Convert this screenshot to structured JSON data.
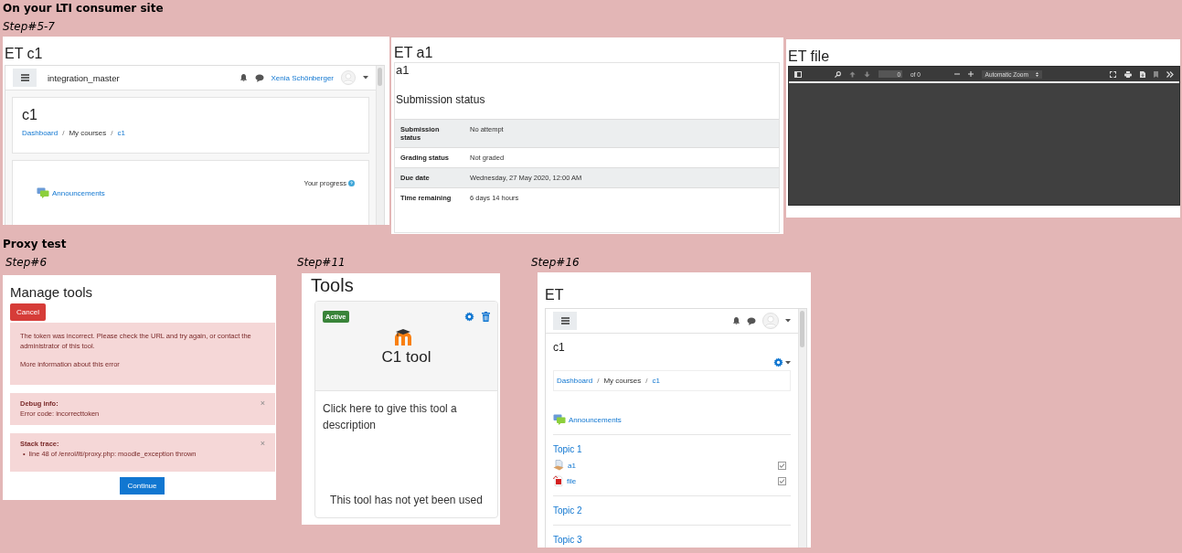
{
  "heading": "On your LTI consumer site",
  "consumer_step": "Step#5-7",
  "course_panel": {
    "title": "ET c1",
    "site_name": "integration_master",
    "user": "Xenia Schönberger",
    "course": "c1",
    "breadcrumb": [
      {
        "label": "Dashboard",
        "kind": "link"
      },
      {
        "separator": "/",
        "label": "My courses",
        "kind": "text"
      },
      {
        "separator": "/",
        "label": "c1",
        "kind": "link"
      }
    ],
    "progress_label": "Your progress",
    "activity": "Announcements"
  },
  "assignment_panel": {
    "title": "ET a1",
    "name": "a1",
    "section": "Submission status",
    "rows": [
      {
        "label": "Submission status",
        "value": "No attempt"
      },
      {
        "label": "Grading status",
        "value": "Not graded"
      },
      {
        "label": "Due date",
        "value": "Wednesday, 27 May 2020, 12:00 AM"
      },
      {
        "label": "Time remaining",
        "value": "6 days 14 hours"
      }
    ]
  },
  "file_panel": {
    "title": "ET file",
    "page": "0",
    "page_count": "of 0",
    "zoom": "Automatic Zoom"
  },
  "proxy_heading": "Proxy test",
  "error_panel": {
    "step": "Step#6",
    "title": "Manage tools",
    "cancel": "Cancel",
    "message": "The token was incorrect. Please check the URL and try again, or contact the administrator of this tool.",
    "more_link": "More information about this error",
    "debug": {
      "title": "Debug info:",
      "text": "Error code: incorrecttoken",
      "close": "×"
    },
    "stack": {
      "title": "Stack trace:",
      "items": [
        {
          "bullet": "•",
          "text": "line 48 of /enrol/lti/proxy.php: moodle_exception thrown"
        }
      ],
      "close": "×"
    },
    "continue": "Continue"
  },
  "tools_panel": {
    "step": "Step#11",
    "title": "Tools",
    "badge": "Active",
    "tool_name": "C1 tool",
    "description": "Click here to give this tool a description",
    "usage": "This tool has not yet been used"
  },
  "et_panel": {
    "step": "Step#16",
    "title": "ET",
    "course": "c1",
    "breadcrumb": [
      {
        "label": "Dashboard",
        "kind": "link"
      },
      {
        "separator": "/",
        "label": "My courses",
        "kind": "text"
      },
      {
        "separator": "/",
        "label": "c1",
        "kind": "link"
      }
    ],
    "activity": "Announcements",
    "sections": [
      {
        "name": "Topic 1",
        "activities": [
          {
            "name": "a1",
            "kind": "assignment",
            "checked": true
          },
          {
            "name": "file",
            "kind": "pdf",
            "checked": true
          }
        ]
      },
      {
        "name": "Topic 2"
      },
      {
        "name": "Topic 3"
      }
    ]
  }
}
